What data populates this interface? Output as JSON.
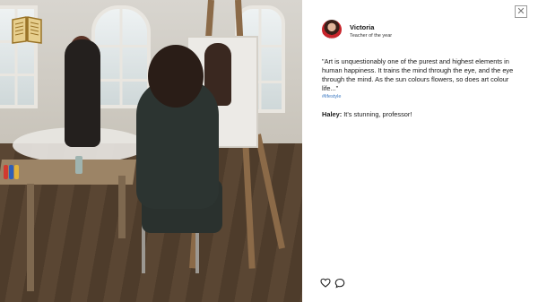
{
  "post": {
    "username": "Victoria",
    "subtitle": "Teacher of the year",
    "caption": "\"Art is unquestionably one of the purest and highest elements in human happiness. It trains the mind through the eye, and the eye through the mind. As the sun colours flowers, so does art colour life...\"",
    "hashtag": "#lifestyle",
    "comment_author": "Haley:",
    "comment_text": " It's stunning, professor!",
    "close_symbol": "✕"
  },
  "icons": {
    "book": "book-icon",
    "like": "heart-icon",
    "comment": "speech-bubble-icon",
    "close": "close-icon"
  },
  "colors": {
    "hashtag": "#3d7ac2",
    "panel_bg": "#ffffff",
    "book_gold": "#c9a24a"
  }
}
